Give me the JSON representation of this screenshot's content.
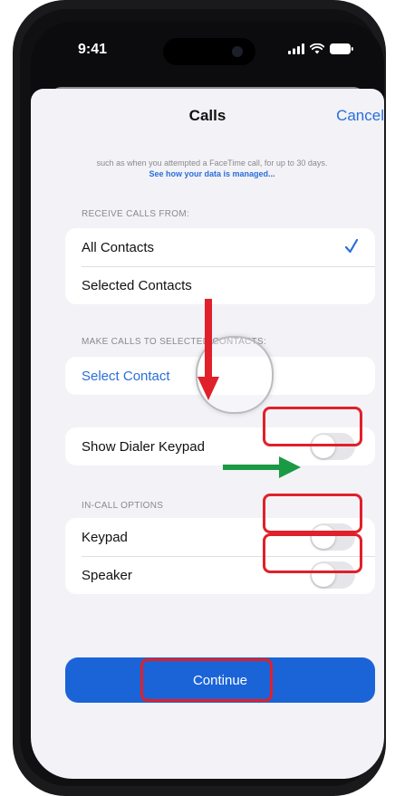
{
  "status_bar": {
    "time": "9:41"
  },
  "nav": {
    "title": "Calls",
    "cancel_label": "Cancel"
  },
  "info": {
    "text": "such as when you attempted a FaceTime call, for up to 30 days.",
    "link": "See how your data is managed..."
  },
  "receive_section": {
    "header": "RECEIVE CALLS FROM:",
    "options": [
      {
        "label": "All Contacts",
        "selected": true
      },
      {
        "label": "Selected Contacts",
        "selected": false
      }
    ]
  },
  "make_section": {
    "header": "MAKE CALLS TO SELECTED CONTACTS:",
    "select_contact_label": "Select Contact"
  },
  "dialer": {
    "label": "Show Dialer Keypad",
    "on": false
  },
  "incall_section": {
    "header": "IN-CALL OPTIONS",
    "options": [
      {
        "label": "Keypad",
        "on": false
      },
      {
        "label": "Speaker",
        "on": false
      }
    ]
  },
  "continue_label": "Continue",
  "colors": {
    "accent": "#2a6fd8",
    "button": "#1b64d8",
    "annotation_red": "#e0202a",
    "annotation_green": "#1a9a44",
    "background": "#f2f2f7"
  }
}
